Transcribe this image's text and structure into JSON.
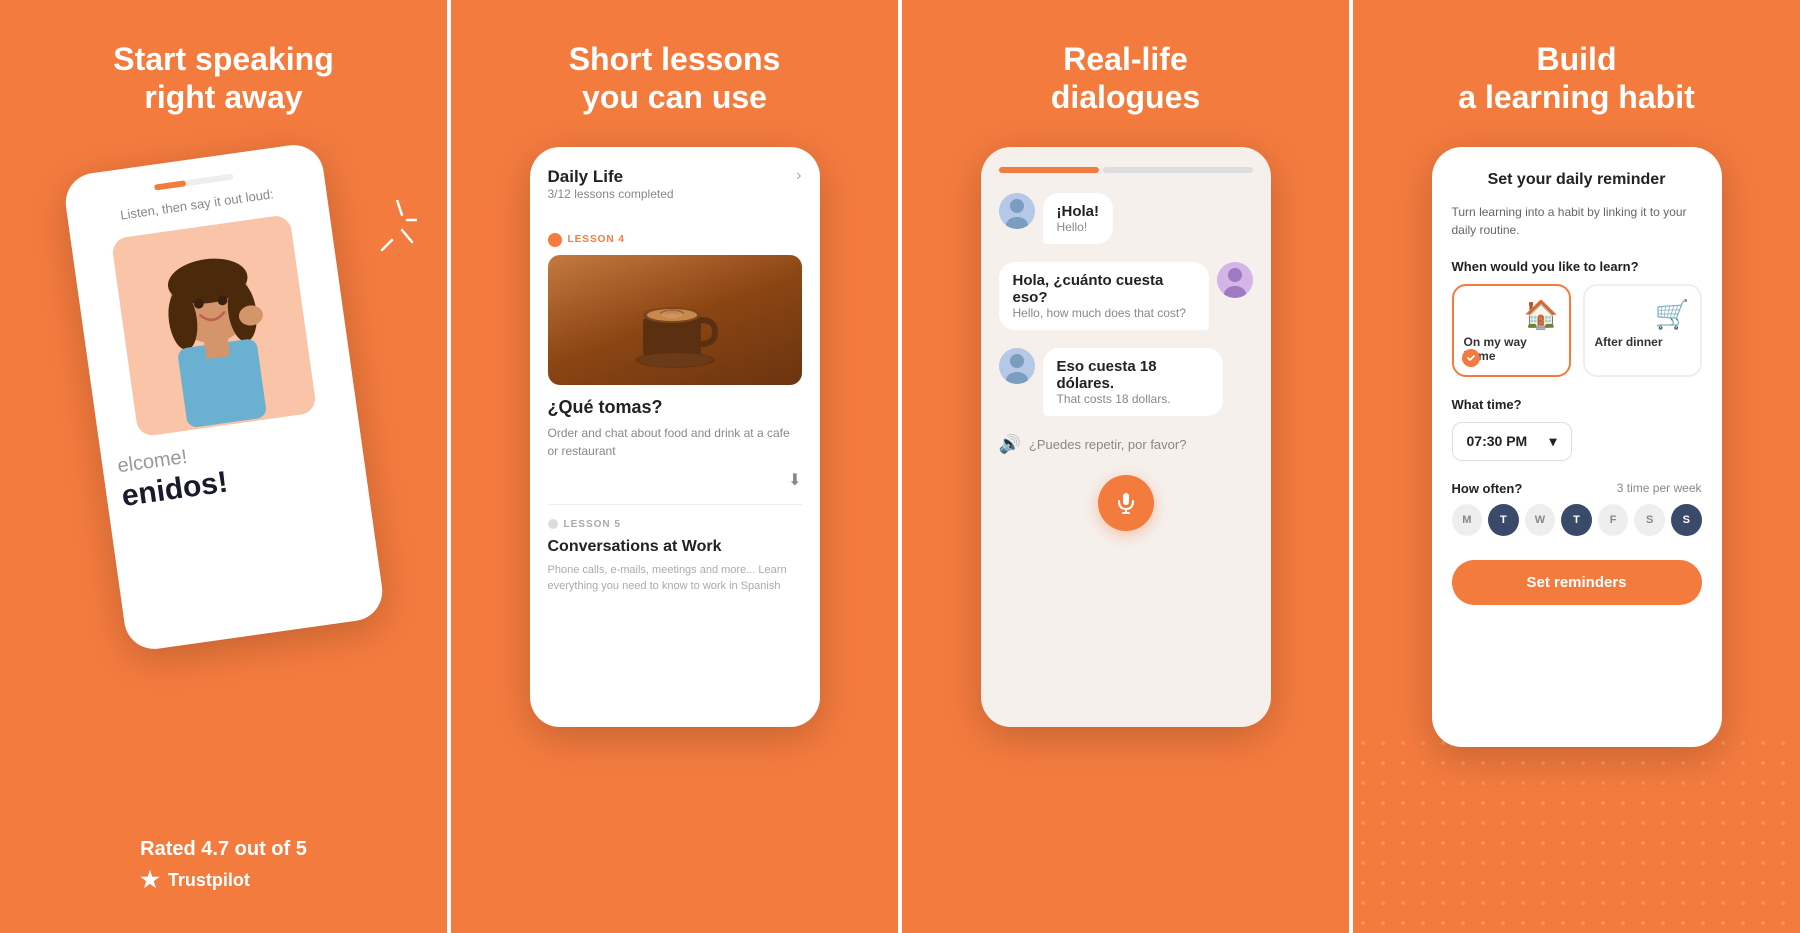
{
  "panel1": {
    "title_line1": "Start speaking",
    "title_line2": "right away",
    "phone": {
      "subtitle": "Listen, then say it out loud:",
      "welcome": "elcome!",
      "bienvenidos": "enidos!"
    },
    "rating": {
      "text": "Rated ",
      "score": "4.7",
      "suffix": " out of 5",
      "brand": "Trustpilot"
    }
  },
  "panel2": {
    "title": "Short lessons",
    "title2": "you can use",
    "phone": {
      "category": "Daily Life",
      "progress": "3/12 lessons completed",
      "lesson4_label": "LESSON 4",
      "lesson4_title": "¿Qué tomas?",
      "lesson4_desc": "Order and chat about food and drink at a cafe or restaurant",
      "lesson5_label": "LESSON 5",
      "lesson5_title": "Conversations at Work",
      "lesson5_desc": "Phone calls, e-mails, meetings and more... Learn everything you need to know to work in Spanish"
    }
  },
  "panel3": {
    "title_line1": "Real-life",
    "title_line2": "dialogues",
    "phone": {
      "bubble1_main": "¡Hola!",
      "bubble1_sub": "Hello!",
      "bubble2_main": "Hola, ¿cuánto cuesta eso?",
      "bubble2_sub": "Hello, how much does that cost?",
      "bubble3_main": "Eso cuesta 18 dólares.",
      "bubble3_sub": "That costs 18 dollars.",
      "repeat": "¿Puedes repetir, por favor?"
    }
  },
  "panel4": {
    "title_line1": "Build",
    "title_line2": "a learning habit",
    "phone": {
      "section_title": "Set your daily reminder",
      "description": "Turn learning into a habit by linking it to your daily routine.",
      "when_label": "When would you like to learn?",
      "option1": "On my way home",
      "option2": "After dinner",
      "what_time_label": "What time?",
      "time_value": "07:30 PM",
      "how_often_label": "How often?",
      "frequency": "3 time per week",
      "days": [
        "M",
        "T",
        "W",
        "T",
        "F",
        "S",
        "S"
      ],
      "active_days": [
        1,
        3,
        6
      ],
      "set_btn": "Set reminders"
    }
  }
}
